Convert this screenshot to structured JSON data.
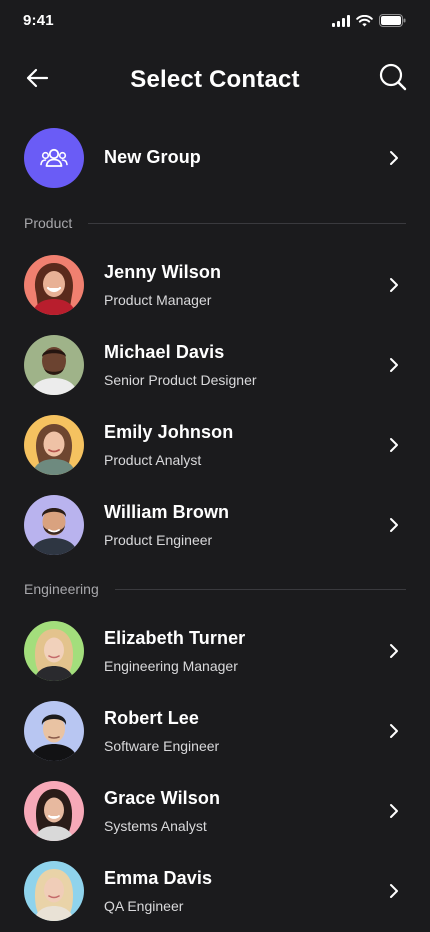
{
  "status_bar": {
    "time": "9:41"
  },
  "header": {
    "title": "Select Contact",
    "back_icon": "arrow-left-icon",
    "search_icon": "search-icon"
  },
  "new_group": {
    "label": "New Group",
    "icon": "group-icon",
    "accent": "#6a5cf6"
  },
  "sections": [
    {
      "label": "Product",
      "contacts": [
        {
          "name": "Jenny Wilson",
          "role": "Product Manager",
          "avatar_bg": "#f08070"
        },
        {
          "name": "Michael Davis",
          "role": "Senior Product Designer",
          "avatar_bg": "#9fb389"
        },
        {
          "name": "Emily Johnson",
          "role": "Product Analyst",
          "avatar_bg": "#f5c260"
        },
        {
          "name": "William Brown",
          "role": "Product Engineer",
          "avatar_bg": "#b9b3ee"
        }
      ]
    },
    {
      "label": "Engineering",
      "contacts": [
        {
          "name": "Elizabeth Turner",
          "role": "Engineering Manager",
          "avatar_bg": "#a3de7c"
        },
        {
          "name": "Robert Lee",
          "role": "Software Engineer",
          "avatar_bg": "#b8c6f2"
        },
        {
          "name": "Grace Wilson",
          "role": "Systems Analyst",
          "avatar_bg": "#f7a9b8"
        },
        {
          "name": "Emma Davis",
          "role": "QA Engineer",
          "avatar_bg": "#8fd3ec"
        }
      ]
    }
  ]
}
